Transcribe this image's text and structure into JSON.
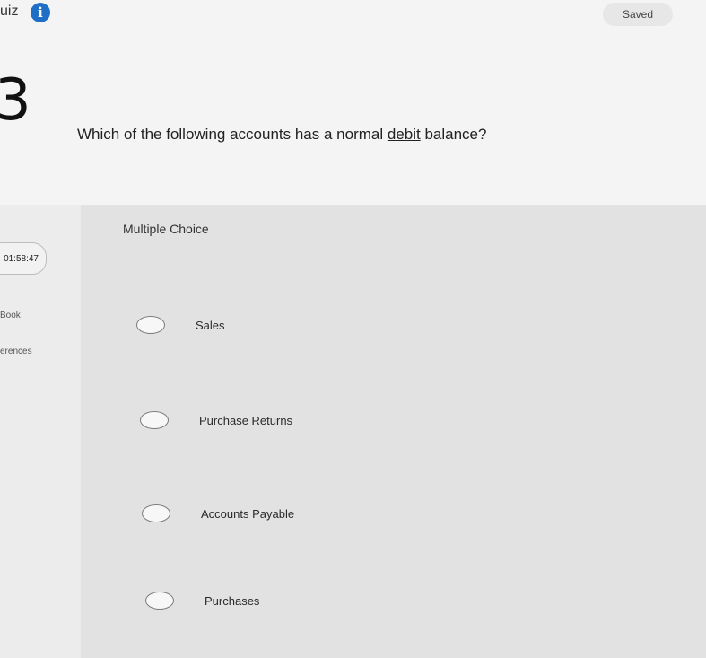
{
  "header": {
    "quiz_title": "uiz",
    "saved_label": "Saved"
  },
  "question": {
    "number": "3",
    "text_before": "Which of the following accounts has a normal ",
    "text_underlined": "debit",
    "text_after": " balance?"
  },
  "sidebar": {
    "timer": "01:58:47",
    "book_label": "Book",
    "references_label": "erences"
  },
  "answer": {
    "type_label": "Multiple Choice",
    "options": [
      {
        "label": "Sales"
      },
      {
        "label": "Purchase Returns"
      },
      {
        "label": "Accounts Payable"
      },
      {
        "label": "Purchases"
      }
    ]
  }
}
